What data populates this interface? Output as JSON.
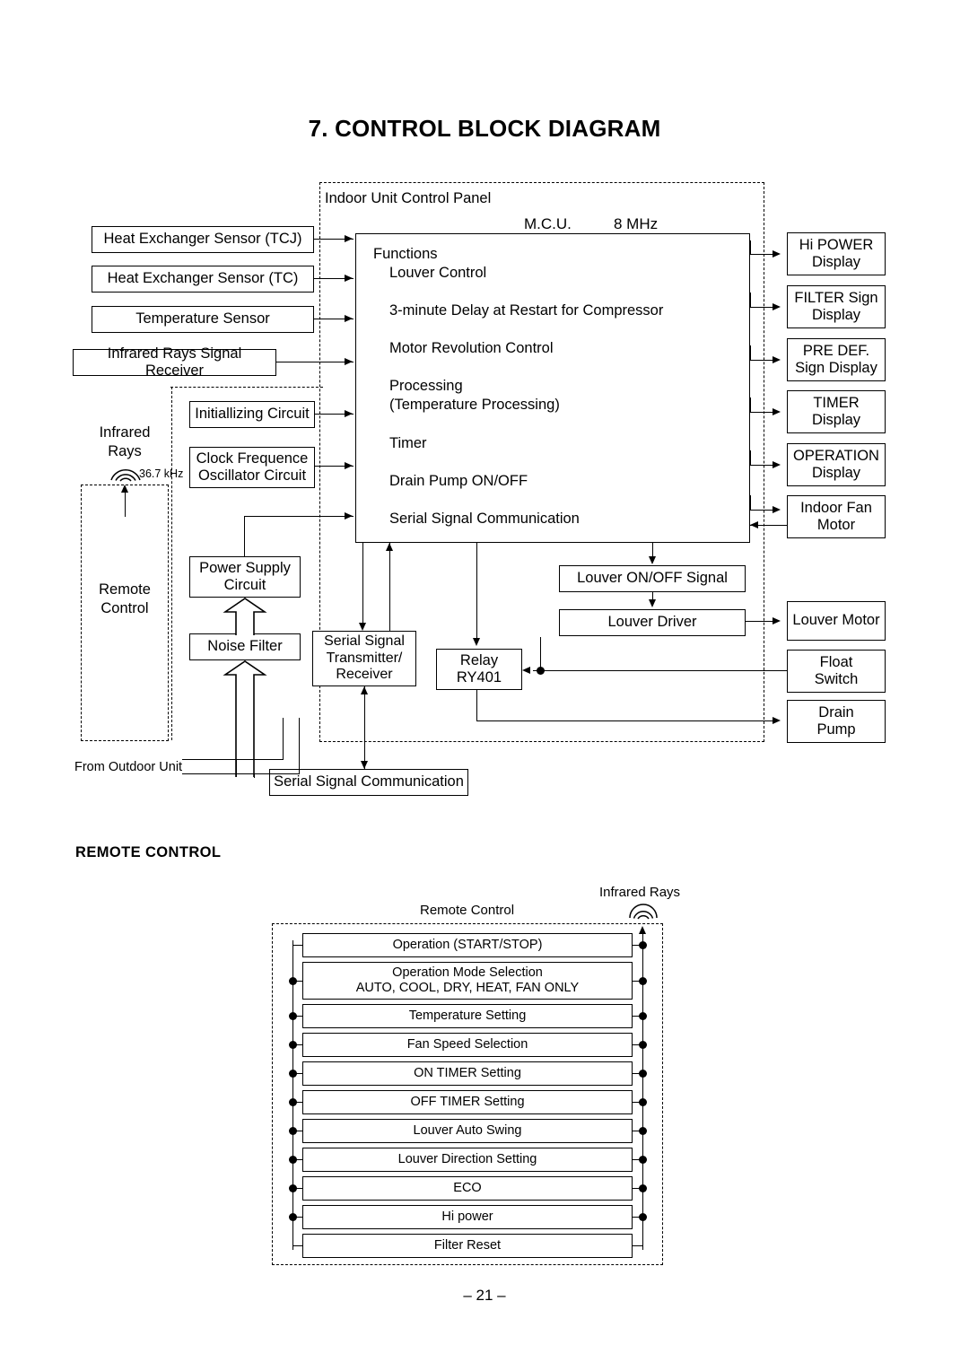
{
  "page": {
    "title": "7. CONTROL BLOCK DIAGRAM",
    "section_remote": "REMOTE CONTROL",
    "page_number": "– 21 –"
  },
  "indoor_panel": {
    "label": "Indoor Unit Control Panel",
    "mcu_label": "M.C.U.",
    "clock_label": "8 MHz"
  },
  "mcu": {
    "heading": "Functions",
    "functions": [
      "Louver Control",
      "3-minute Delay at Restart for Compressor",
      "Motor Revolution Control",
      "Processing\n(Temperature Processing)",
      "Timer",
      "Drain Pump ON/OFF",
      "Serial Signal Communication"
    ],
    "functions_flat": [
      "Louver Control",
      "3-minute Delay at Restart for Compressor",
      "Motor Revolution Control",
      "Processing",
      "(Temperature Processing)",
      "Timer",
      "Drain Pump ON/OFF",
      "Serial Signal Communication"
    ]
  },
  "inputs": [
    "Heat Exchanger Sensor (TCJ)",
    "Heat Exchanger Sensor (TC)",
    "Temperature Sensor",
    "Infrared Rays Signal Receiver"
  ],
  "circuits": {
    "initializing": "Initiallizing Circuit",
    "clock_oscillator": "Clock Frequence\nOscillator Circuit",
    "clock_oscillator_line1": "Clock Frequence",
    "clock_oscillator_line2": "Oscillator Circuit",
    "power_supply_line1": "Power Supply",
    "power_supply_line2": "Circuit",
    "noise_filter": "Noise Filter",
    "serial_txrx_line1": "Serial Signal",
    "serial_txrx_line2": "Transmitter/",
    "serial_txrx_line3": "Receiver",
    "relay_line1": "Relay",
    "relay_line2": "RY401",
    "louver_onoff": "Louver ON/OFF Signal",
    "louver_driver": "Louver Driver",
    "serial_comm": "Serial Signal Communication"
  },
  "outputs": [
    {
      "line1": "Hi POWER",
      "line2": "Display"
    },
    {
      "line1": "FILTER Sign",
      "line2": "Display"
    },
    {
      "line1": "PRE DEF.",
      "line2": "Sign Display"
    },
    {
      "line1": "TIMER",
      "line2": "Display"
    },
    {
      "line1": "OPERATION",
      "line2": "Display"
    },
    {
      "line1": "Indoor Fan",
      "line2": "Motor"
    },
    {
      "line1": "Louver Motor",
      "line2": ""
    },
    {
      "line1": "Float",
      "line2": "Switch"
    },
    {
      "line1": "Drain",
      "line2": "Pump"
    }
  ],
  "annotations": {
    "infrared_rays_line1": "Infrared",
    "infrared_rays_line2": "Rays",
    "infrared_frequency": "36.7 kHz",
    "remote_control_line1": "Remote",
    "remote_control_line2": "Control",
    "from_outdoor_unit": "From Outdoor Unit"
  },
  "remote_control_section": {
    "title_above_box": "Remote Control",
    "infrared_rays": "Infrared Rays",
    "items": [
      {
        "line1": "Operation (START/STOP)",
        "line2": ""
      },
      {
        "line1": "Operation Mode Selection",
        "line2": "AUTO, COOL, DRY, HEAT, FAN ONLY"
      },
      {
        "line1": "Temperature Setting",
        "line2": ""
      },
      {
        "line1": "Fan Speed Selection",
        "line2": ""
      },
      {
        "line1": "ON TIMER Setting",
        "line2": ""
      },
      {
        "line1": "OFF TIMER Setting",
        "line2": ""
      },
      {
        "line1": "Louver Auto Swing",
        "line2": ""
      },
      {
        "line1": "Louver Direction Setting",
        "line2": ""
      },
      {
        "line1": "ECO",
        "line2": ""
      },
      {
        "line1": "Hi power",
        "line2": ""
      },
      {
        "line1": "Filter Reset",
        "line2": ""
      }
    ]
  },
  "colors": {
    "ink": "#000000",
    "paper": "#ffffff"
  }
}
